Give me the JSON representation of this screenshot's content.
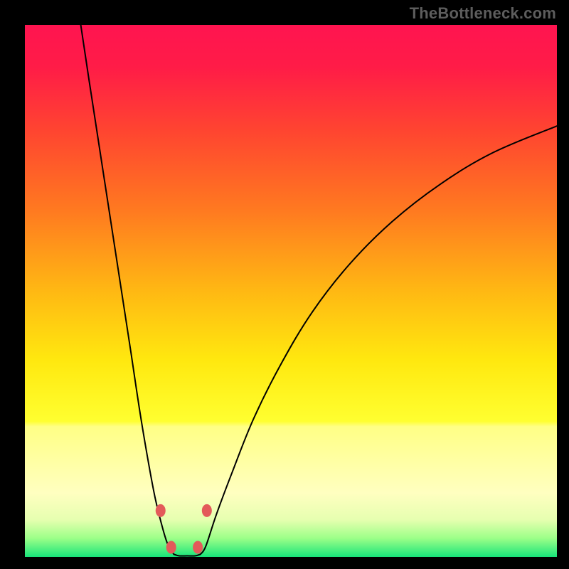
{
  "watermark": "TheBottleneck.com",
  "chart_data": {
    "type": "line",
    "title": "",
    "xlabel": "",
    "ylabel": "",
    "xlim": [
      0,
      100
    ],
    "ylim": [
      0,
      100
    ],
    "grid": false,
    "legend": false,
    "gradient_stops": [
      {
        "offset": 0.0,
        "color": "#ff1450"
      },
      {
        "offset": 0.08,
        "color": "#ff1c47"
      },
      {
        "offset": 0.2,
        "color": "#ff4530"
      },
      {
        "offset": 0.35,
        "color": "#ff7a20"
      },
      {
        "offset": 0.5,
        "color": "#ffb813"
      },
      {
        "offset": 0.63,
        "color": "#ffe80f"
      },
      {
        "offset": 0.745,
        "color": "#ffff30"
      },
      {
        "offset": 0.755,
        "color": "#ffff85"
      },
      {
        "offset": 0.88,
        "color": "#ffffc0"
      },
      {
        "offset": 0.93,
        "color": "#e6ffb0"
      },
      {
        "offset": 0.965,
        "color": "#9cff88"
      },
      {
        "offset": 1.0,
        "color": "#18e47a"
      }
    ],
    "series": [
      {
        "name": "left-branch",
        "x": [
          10.5,
          12.0,
          14.0,
          16.0,
          18.0,
          20.0,
          21.5,
          23.0,
          24.5,
          26.0,
          27.0,
          28.0
        ],
        "y": [
          100,
          90,
          77,
          64,
          51,
          38,
          28,
          19,
          11,
          5,
          2,
          0.5
        ]
      },
      {
        "name": "right-branch",
        "x": [
          33.0,
          34.0,
          36.0,
          39.0,
          43.0,
          48.0,
          54.0,
          61.0,
          69.0,
          78.0,
          88.0,
          100.0
        ],
        "y": [
          0.5,
          2,
          8,
          16,
          26,
          36,
          46,
          55,
          63,
          70,
          76,
          81
        ]
      },
      {
        "name": "trough",
        "x": [
          28.0,
          29.0,
          30.5,
          32.0,
          33.0
        ],
        "y": [
          0.5,
          0.2,
          0.2,
          0.2,
          0.5
        ]
      }
    ],
    "markers": [
      {
        "name": "m1",
        "x": 25.5,
        "y": 8.7
      },
      {
        "name": "m2",
        "x": 27.5,
        "y": 1.8
      },
      {
        "name": "m3",
        "x": 32.5,
        "y": 1.8
      },
      {
        "name": "m4",
        "x": 34.2,
        "y": 8.7
      }
    ],
    "marker_style": {
      "fill": "#e35a5a",
      "rx": 7,
      "ry": 9
    }
  }
}
